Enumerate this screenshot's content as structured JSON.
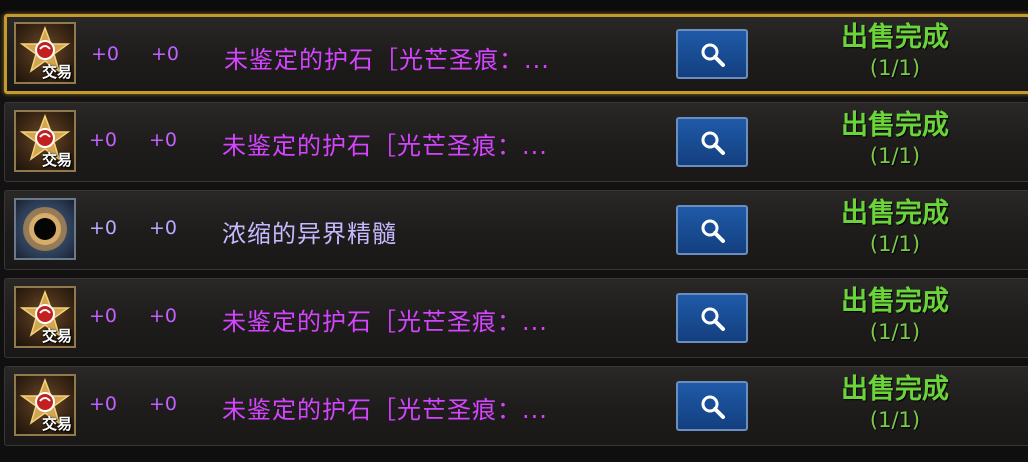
{
  "items": [
    {
      "icon": "star-emblem-icon",
      "trade_tag": "交易",
      "stat1": "+0",
      "stat2": "+0",
      "name": "未鉴定的护石［光芒圣痕：...",
      "status": "出售完成",
      "count": "(1/1)",
      "selected": true
    },
    {
      "icon": "star-emblem-icon",
      "trade_tag": "交易",
      "stat1": "+0",
      "stat2": "+0",
      "name": "未鉴定的护石［光芒圣痕：...",
      "status": "出售完成",
      "count": "(1/1)",
      "selected": false
    },
    {
      "icon": "dark-orb-icon",
      "trade_tag": "",
      "stat1": "+0",
      "stat2": "+0",
      "name": "浓缩的异界精髓",
      "status": "出售完成",
      "count": "(1/1)",
      "selected": false
    },
    {
      "icon": "star-emblem-icon",
      "trade_tag": "交易",
      "stat1": "+0",
      "stat2": "+0",
      "name": "未鉴定的护石［光芒圣痕：...",
      "status": "出售完成",
      "count": "(1/1)",
      "selected": false
    },
    {
      "icon": "star-emblem-icon",
      "trade_tag": "交易",
      "stat1": "+0",
      "stat2": "+0",
      "name": "未鉴定的护石［光芒圣痕：...",
      "status": "出售完成",
      "count": "(1/1)",
      "selected": false
    }
  ],
  "colors": {
    "selected_border": "#c39a2b",
    "epic_name": "#d444ff",
    "rare_name": "#c7b9ff",
    "status_green": "#6bd43a",
    "button_blue": "#1f5aa8"
  }
}
